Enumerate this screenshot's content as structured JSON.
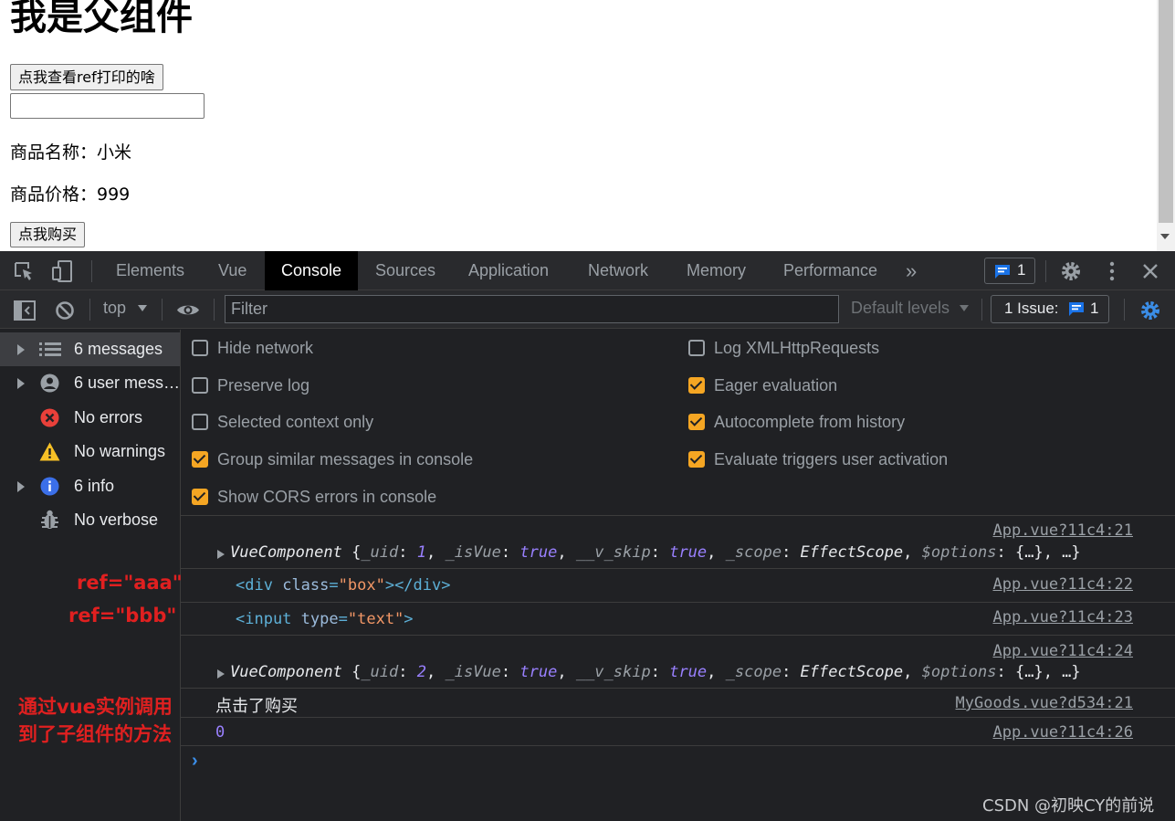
{
  "page": {
    "title": "我是父组件",
    "ref_button": "点我查看ref打印的啥",
    "input_value": "",
    "product_name": "商品名称：小米",
    "product_price": "商品价格：999",
    "buy_button": "点我购买"
  },
  "devtools": {
    "tabs": [
      "Elements",
      "Vue",
      "Console",
      "Sources",
      "Application",
      "Network",
      "Memory",
      "Performance"
    ],
    "active_tab": "Console",
    "more_tabs": "»",
    "messages_badge": "1",
    "context": "top",
    "filter_placeholder": "Filter",
    "levels": "Default levels",
    "issue_label": "1 Issue:",
    "issue_count": "1",
    "sidebar": [
      {
        "label": "6 messages",
        "icon": "list-icon"
      },
      {
        "label": "6 user mess…",
        "icon": "user-icon"
      },
      {
        "label": "No errors",
        "icon": "error-icon"
      },
      {
        "label": "No warnings",
        "icon": "warning-icon"
      },
      {
        "label": "6 info",
        "icon": "info-icon"
      },
      {
        "label": "No verbose",
        "icon": "bug-icon"
      }
    ],
    "settings_left": [
      {
        "label": "Hide network",
        "checked": false
      },
      {
        "label": "Preserve log",
        "checked": false
      },
      {
        "label": "Selected context only",
        "checked": false
      },
      {
        "label": "Group similar messages in console",
        "checked": true
      },
      {
        "label": "Show CORS errors in console",
        "checked": true
      }
    ],
    "settings_right": [
      {
        "label": "Log XMLHttpRequests",
        "checked": false
      },
      {
        "label": "Eager evaluation",
        "checked": true
      },
      {
        "label": "Autocomplete from history",
        "checked": true
      },
      {
        "label": "Evaluate triggers user activation",
        "checked": true
      }
    ],
    "logs": [
      {
        "source": "App.vue?11c4:21",
        "uid": "1"
      },
      {
        "source": "App.vue?11c4:22"
      },
      {
        "source": "App.vue?11c4:23"
      },
      {
        "source": "App.vue?11c4:24",
        "uid": "2"
      },
      {
        "source": "MyGoods.vue?d534:21",
        "text": "点击了购买"
      },
      {
        "source": "App.vue?11c4:26",
        "text": "0"
      }
    ]
  },
  "annotations": {
    "ref_aaa": "ref=\"aaa\"",
    "ref_bbb": "ref=\"bbb\"",
    "note_line1": "通过vue实例调用",
    "note_line2": "到了子组件的方法"
  },
  "watermark": "CSDN @初映CY的前说",
  "colors": {
    "checkbox_on": "#f5a623",
    "annotation": "#e02020",
    "console_bg": "#202124"
  }
}
